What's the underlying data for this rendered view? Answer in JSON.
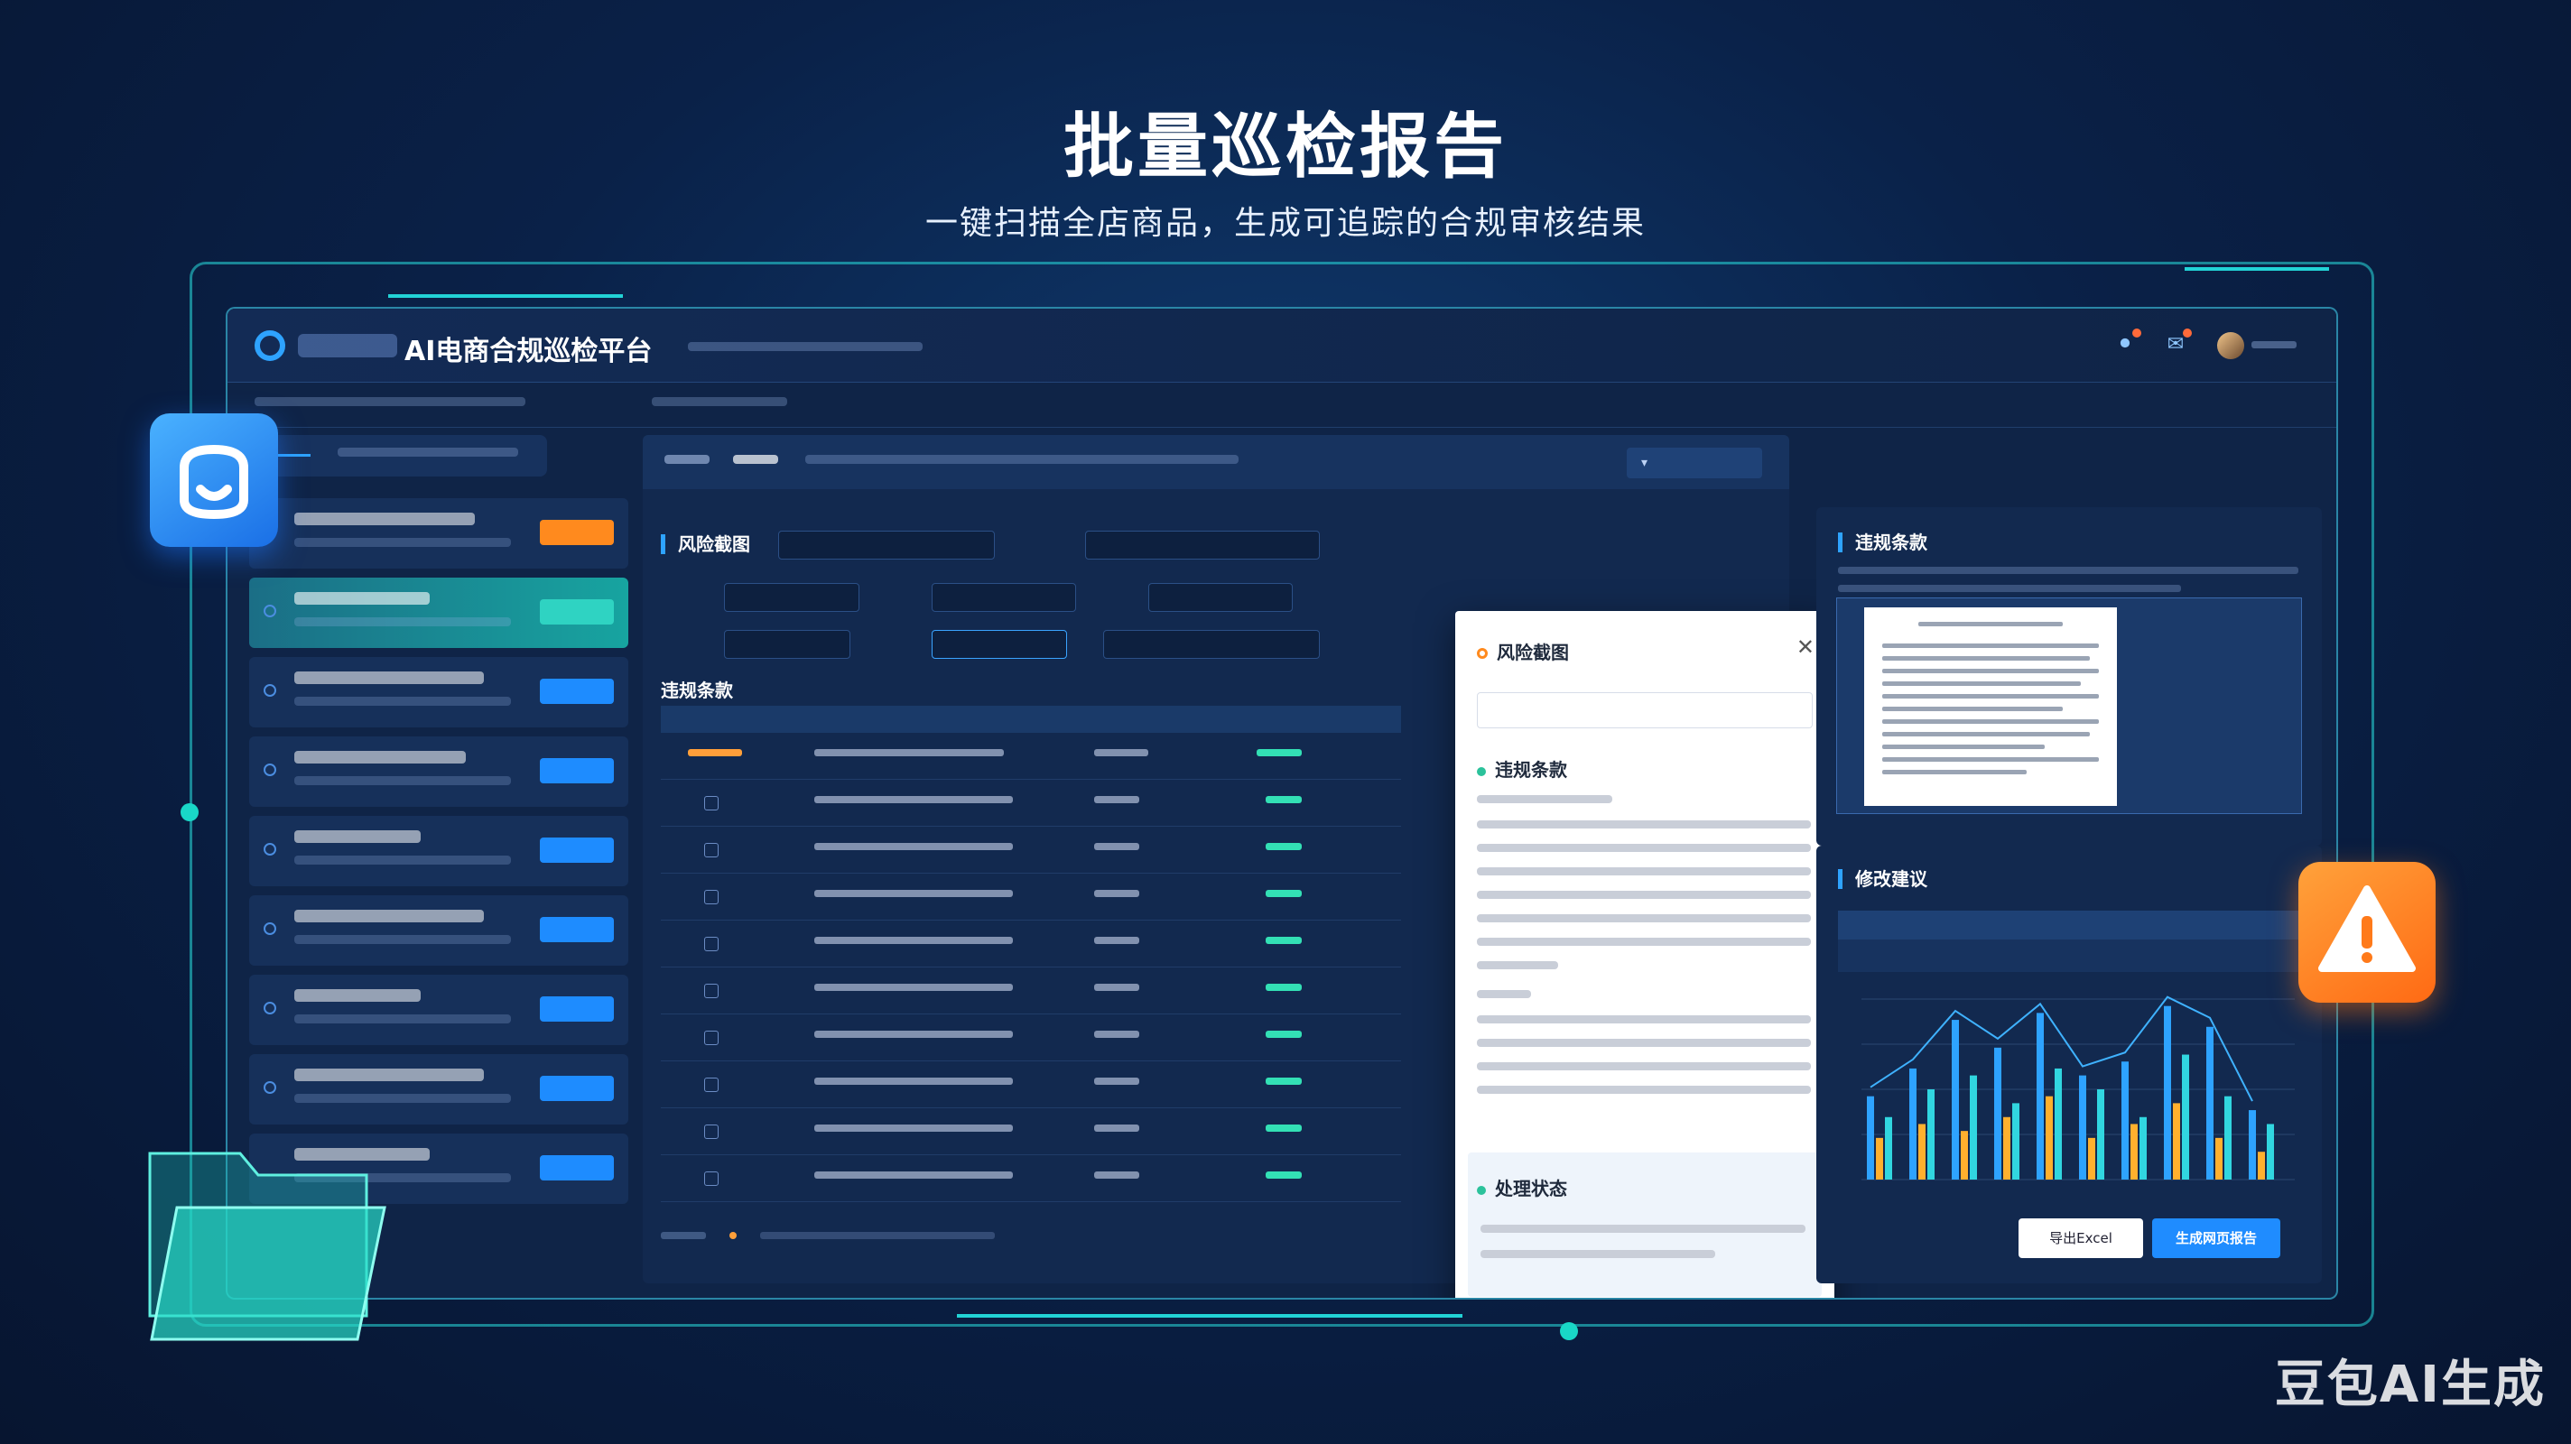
{
  "hero": {
    "title": "批量巡检报告",
    "subtitle": "一键扫描全店商品，生成可追踪的合规审核结果"
  },
  "app": {
    "title": "AI电商合规巡检平台",
    "accent_color": "#2ea3ff",
    "header_icons": [
      "bell-icon",
      "message-icon"
    ]
  },
  "center": {
    "risk_section_title": "风险截图",
    "violation_section_title": "违规条款"
  },
  "popup": {
    "title": "风险截图",
    "section_violation": "违规条款",
    "section_status": "处理状态"
  },
  "right": {
    "violation_title": "违规条款",
    "suggestion_title": "修改建议",
    "export_label": "导出Excel",
    "generate_label": "生成网页报告"
  },
  "chart_data": {
    "type": "bar",
    "series": [
      {
        "values": [
          120,
          160,
          230,
          190,
          240,
          150,
          170,
          250,
          220,
          100
        ]
      },
      {
        "values": [
          60,
          80,
          70,
          90,
          120,
          60,
          80,
          110,
          60,
          40
        ]
      },
      {
        "values": [
          90,
          130,
          150,
          110,
          160,
          130,
          90,
          180,
          120,
          80
        ]
      }
    ],
    "colors": [
      "#2ea3ff",
      "#ffb02e",
      "#31d6e0"
    ]
  },
  "watermark": "豆包AI生成"
}
